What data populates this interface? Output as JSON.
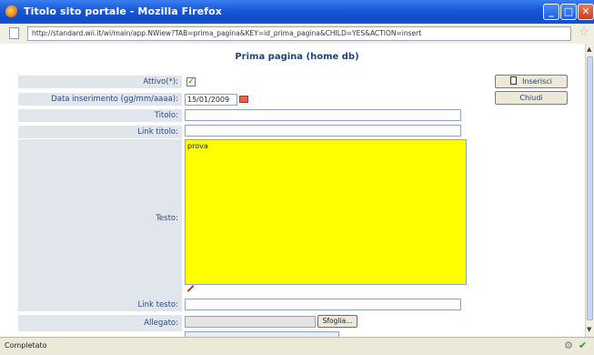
{
  "window": {
    "title": "Titolo sito portale - Mozilla Firefox"
  },
  "addressbar": {
    "url": "http://standard.wii.it/wi/main/app.NWiew?TAB=prima_pagina&KEY=id_prima_pagina&CHILD=YES&ACTION=insert"
  },
  "form": {
    "heading": "Prima pagina (home db)",
    "attivo_label": "Attivo(*):",
    "attivo_checked": true,
    "data_label": "Data inserimento (gg/mm/aaaa):",
    "data_value": "15/01/2009",
    "titolo_label": "Titolo:",
    "titolo_value": "",
    "link_titolo_label": "Link titolo:",
    "link_titolo_value": "",
    "testo_label": "Testo:",
    "testo_value": "prova",
    "link_testo_label": "Link testo:",
    "link_testo_value": "",
    "allegato_label": "Allegato:",
    "browse_label": "Sfoglia..."
  },
  "actions": {
    "inserisci_label": "Inserisci",
    "chiudi_label": "Chiudi"
  },
  "status": {
    "text": "Completato"
  },
  "colors": {
    "titlebar": "#1656d8",
    "textarea_bg": "#ffff00",
    "label_bg": "#e1e5ec",
    "heading": "#21437c"
  }
}
